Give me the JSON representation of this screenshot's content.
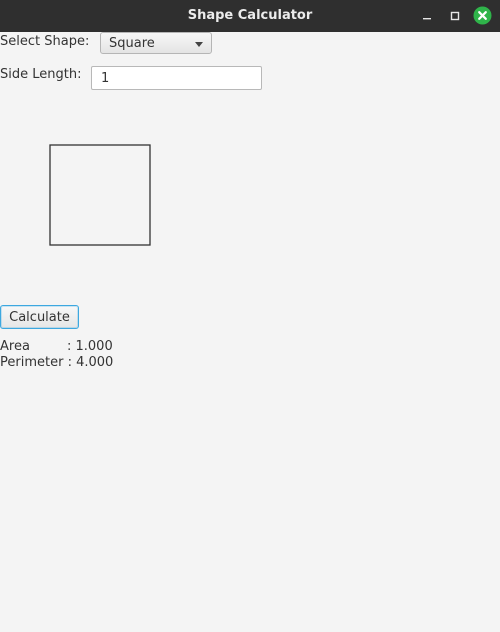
{
  "window": {
    "title": "Shape Calculator",
    "close_color": "#2fb44a"
  },
  "form": {
    "shape_label": "Select Shape:",
    "shape_value": "Square",
    "side_label": "Side Length:",
    "side_value": "1"
  },
  "preview": {
    "shape": "square",
    "stroke_color": "#333333"
  },
  "actions": {
    "calculate_label": "Calculate"
  },
  "results": {
    "area_label": "Area",
    "area_value": ": 1.000",
    "perimeter_label": "Perimeter",
    "perimeter_value": ": 4.000"
  },
  "icons": {
    "minimize": "minimize-icon",
    "maximize": "maximize-icon",
    "close": "close-icon",
    "dropdown": "chevron-down-icon"
  }
}
